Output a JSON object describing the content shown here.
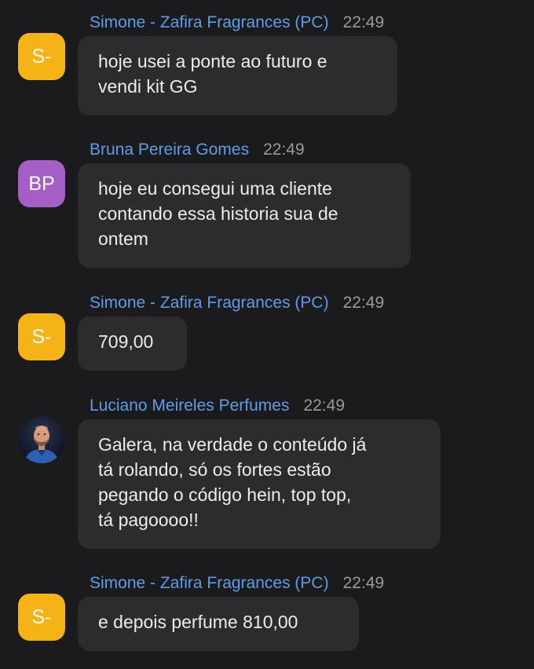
{
  "messages": [
    {
      "sender": "Simone - Zafira Fragrances (PC)",
      "time": "22:49",
      "avatar_initials": "S-",
      "avatar_color": "#f5b316",
      "lines": [
        "hoje usei a ponte ao futuro e",
        "vendi kit GG"
      ]
    },
    {
      "sender": "Bruna Pereira Gomes",
      "time": "22:49",
      "avatar_initials": "BP",
      "avatar_color": "#a55ec6",
      "lines": [
        "hoje eu consegui uma cliente",
        "contando essa historia sua de",
        "ontem"
      ]
    },
    {
      "sender": "Simone - Zafira Fragrances (PC)",
      "time": "22:49",
      "avatar_initials": "S-",
      "avatar_color": "#f5b316",
      "lines": [
        "709,00"
      ]
    },
    {
      "sender": "Luciano Meireles Perfumes",
      "time": "22:49",
      "avatar_photo": "man-portrait",
      "lines": [
        "Galera, na verdade o conteúdo já",
        "tá rolando, só os fortes estão",
        "pegando o código hein, top top,",
        "tá pagoooo!!"
      ]
    },
    {
      "sender": "Simone - Zafira Fragrances (PC)",
      "time": "22:49",
      "avatar_initials": "S-",
      "avatar_color": "#f5b316",
      "lines": [
        "e depois perfume 810,00"
      ]
    }
  ]
}
